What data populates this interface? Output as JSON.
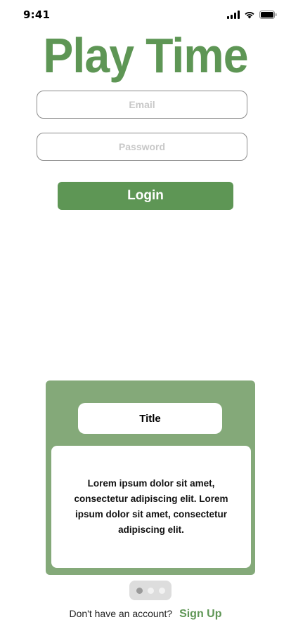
{
  "status_bar": {
    "time": "9:41",
    "icons": [
      "cellular-signal-icon",
      "wifi-icon",
      "battery-icon"
    ]
  },
  "app": {
    "title": "Play Time",
    "accent_color": "#5e9655",
    "card_color": "#84a979"
  },
  "login_form": {
    "email_placeholder": "Email",
    "email_value": "",
    "password_placeholder": "Password",
    "password_value": "",
    "login_label": "Login"
  },
  "card": {
    "title": "Title",
    "body": "Lorem ipsum dolor sit amet, consectetur adipiscing elit. Lorem ipsum dolor sit amet, consectetur adipiscing elit."
  },
  "pager": {
    "total": 3,
    "active_index": 0
  },
  "footer": {
    "prompt": "Don't have an account?",
    "signup_label": "Sign Up"
  }
}
